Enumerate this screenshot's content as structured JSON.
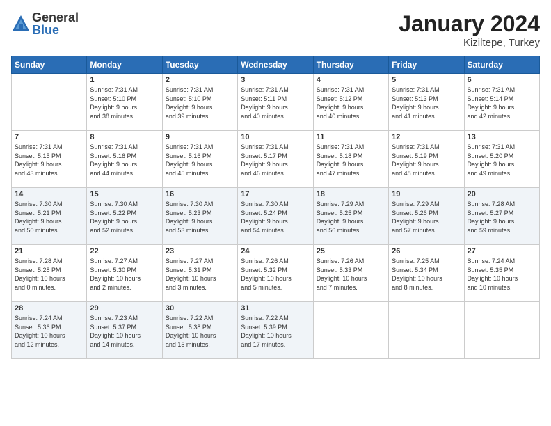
{
  "logo": {
    "general": "General",
    "blue": "Blue"
  },
  "title": "January 2024",
  "location": "Kiziltepe, Turkey",
  "headers": [
    "Sunday",
    "Monday",
    "Tuesday",
    "Wednesday",
    "Thursday",
    "Friday",
    "Saturday"
  ],
  "weeks": [
    [
      {
        "num": "",
        "info": ""
      },
      {
        "num": "1",
        "info": "Sunrise: 7:31 AM\nSunset: 5:10 PM\nDaylight: 9 hours\nand 38 minutes."
      },
      {
        "num": "2",
        "info": "Sunrise: 7:31 AM\nSunset: 5:10 PM\nDaylight: 9 hours\nand 39 minutes."
      },
      {
        "num": "3",
        "info": "Sunrise: 7:31 AM\nSunset: 5:11 PM\nDaylight: 9 hours\nand 40 minutes."
      },
      {
        "num": "4",
        "info": "Sunrise: 7:31 AM\nSunset: 5:12 PM\nDaylight: 9 hours\nand 40 minutes."
      },
      {
        "num": "5",
        "info": "Sunrise: 7:31 AM\nSunset: 5:13 PM\nDaylight: 9 hours\nand 41 minutes."
      },
      {
        "num": "6",
        "info": "Sunrise: 7:31 AM\nSunset: 5:14 PM\nDaylight: 9 hours\nand 42 minutes."
      }
    ],
    [
      {
        "num": "7",
        "info": "Sunrise: 7:31 AM\nSunset: 5:15 PM\nDaylight: 9 hours\nand 43 minutes."
      },
      {
        "num": "8",
        "info": "Sunrise: 7:31 AM\nSunset: 5:16 PM\nDaylight: 9 hours\nand 44 minutes."
      },
      {
        "num": "9",
        "info": "Sunrise: 7:31 AM\nSunset: 5:16 PM\nDaylight: 9 hours\nand 45 minutes."
      },
      {
        "num": "10",
        "info": "Sunrise: 7:31 AM\nSunset: 5:17 PM\nDaylight: 9 hours\nand 46 minutes."
      },
      {
        "num": "11",
        "info": "Sunrise: 7:31 AM\nSunset: 5:18 PM\nDaylight: 9 hours\nand 47 minutes."
      },
      {
        "num": "12",
        "info": "Sunrise: 7:31 AM\nSunset: 5:19 PM\nDaylight: 9 hours\nand 48 minutes."
      },
      {
        "num": "13",
        "info": "Sunrise: 7:31 AM\nSunset: 5:20 PM\nDaylight: 9 hours\nand 49 minutes."
      }
    ],
    [
      {
        "num": "14",
        "info": "Sunrise: 7:30 AM\nSunset: 5:21 PM\nDaylight: 9 hours\nand 50 minutes."
      },
      {
        "num": "15",
        "info": "Sunrise: 7:30 AM\nSunset: 5:22 PM\nDaylight: 9 hours\nand 52 minutes."
      },
      {
        "num": "16",
        "info": "Sunrise: 7:30 AM\nSunset: 5:23 PM\nDaylight: 9 hours\nand 53 minutes."
      },
      {
        "num": "17",
        "info": "Sunrise: 7:30 AM\nSunset: 5:24 PM\nDaylight: 9 hours\nand 54 minutes."
      },
      {
        "num": "18",
        "info": "Sunrise: 7:29 AM\nSunset: 5:25 PM\nDaylight: 9 hours\nand 56 minutes."
      },
      {
        "num": "19",
        "info": "Sunrise: 7:29 AM\nSunset: 5:26 PM\nDaylight: 9 hours\nand 57 minutes."
      },
      {
        "num": "20",
        "info": "Sunrise: 7:28 AM\nSunset: 5:27 PM\nDaylight: 9 hours\nand 59 minutes."
      }
    ],
    [
      {
        "num": "21",
        "info": "Sunrise: 7:28 AM\nSunset: 5:28 PM\nDaylight: 10 hours\nand 0 minutes."
      },
      {
        "num": "22",
        "info": "Sunrise: 7:27 AM\nSunset: 5:30 PM\nDaylight: 10 hours\nand 2 minutes."
      },
      {
        "num": "23",
        "info": "Sunrise: 7:27 AM\nSunset: 5:31 PM\nDaylight: 10 hours\nand 3 minutes."
      },
      {
        "num": "24",
        "info": "Sunrise: 7:26 AM\nSunset: 5:32 PM\nDaylight: 10 hours\nand 5 minutes."
      },
      {
        "num": "25",
        "info": "Sunrise: 7:26 AM\nSunset: 5:33 PM\nDaylight: 10 hours\nand 7 minutes."
      },
      {
        "num": "26",
        "info": "Sunrise: 7:25 AM\nSunset: 5:34 PM\nDaylight: 10 hours\nand 8 minutes."
      },
      {
        "num": "27",
        "info": "Sunrise: 7:24 AM\nSunset: 5:35 PM\nDaylight: 10 hours\nand 10 minutes."
      }
    ],
    [
      {
        "num": "28",
        "info": "Sunrise: 7:24 AM\nSunset: 5:36 PM\nDaylight: 10 hours\nand 12 minutes."
      },
      {
        "num": "29",
        "info": "Sunrise: 7:23 AM\nSunset: 5:37 PM\nDaylight: 10 hours\nand 14 minutes."
      },
      {
        "num": "30",
        "info": "Sunrise: 7:22 AM\nSunset: 5:38 PM\nDaylight: 10 hours\nand 15 minutes."
      },
      {
        "num": "31",
        "info": "Sunrise: 7:22 AM\nSunset: 5:39 PM\nDaylight: 10 hours\nand 17 minutes."
      },
      {
        "num": "",
        "info": ""
      },
      {
        "num": "",
        "info": ""
      },
      {
        "num": "",
        "info": ""
      }
    ]
  ]
}
